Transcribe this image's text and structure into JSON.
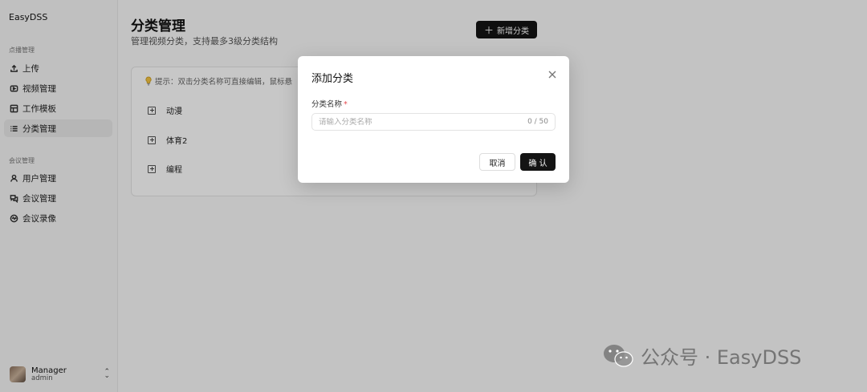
{
  "sidebar": {
    "brand": "EasyDSS",
    "groups": [
      {
        "label": "点播管理",
        "items": [
          {
            "label": "上传",
            "icon": "upload-icon"
          },
          {
            "label": "视频管理",
            "icon": "video-icon"
          },
          {
            "label": "工作模板",
            "icon": "template-icon"
          },
          {
            "label": "分类管理",
            "icon": "list-icon",
            "active": true
          }
        ]
      },
      {
        "label": "会议管理",
        "items": [
          {
            "label": "用户管理",
            "icon": "user-icon"
          },
          {
            "label": "会议管理",
            "icon": "chat-icon"
          },
          {
            "label": "会议录像",
            "icon": "record-icon"
          }
        ]
      }
    ],
    "user": {
      "name": "Manager",
      "role": "admin"
    }
  },
  "main": {
    "title": "分类管理",
    "subtitle": "管理视频分类，支持最多3级分类结构",
    "add_button": "新增分类",
    "tip": "提示：双击分类名称可直接编辑，鼠标悬",
    "categories": [
      "动漫",
      "体育2",
      "编程"
    ]
  },
  "modal": {
    "title": "添加分类",
    "field_label": "分类名称",
    "required_mark": "*",
    "placeholder": "请输入分类名称",
    "value": "",
    "counter": "0 / 50",
    "cancel": "取消",
    "confirm": "确 认"
  },
  "watermark": {
    "text": "公众号 · EasyDSS"
  }
}
